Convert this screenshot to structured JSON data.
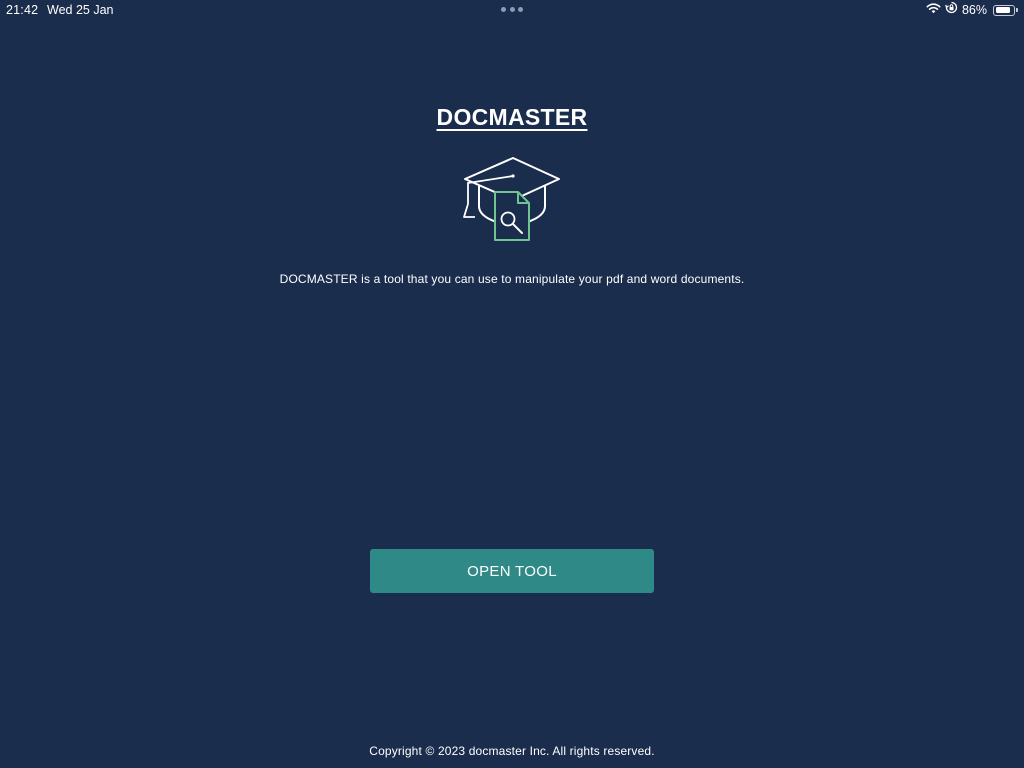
{
  "status_bar": {
    "time": "21:42",
    "date": "Wed 25 Jan",
    "battery_percent_label": "86%",
    "battery_level": 0.86,
    "icons": [
      "wifi-icon",
      "orientation-lock-icon",
      "battery-icon"
    ]
  },
  "app": {
    "title": "DOCMASTER",
    "logo_icon": "graduation-cap-document-search-icon",
    "description": "DOCMASTER is a tool that you can use to manipulate your pdf and word documents.",
    "open_button_label": "OPEN TOOL",
    "footer": "Copyright © 2023 docmaster Inc. All rights reserved."
  },
  "colors": {
    "background": "#1b2d4d",
    "button": "#2f8a87",
    "accent_green": "#6fc48f",
    "text": "#ffffff"
  }
}
